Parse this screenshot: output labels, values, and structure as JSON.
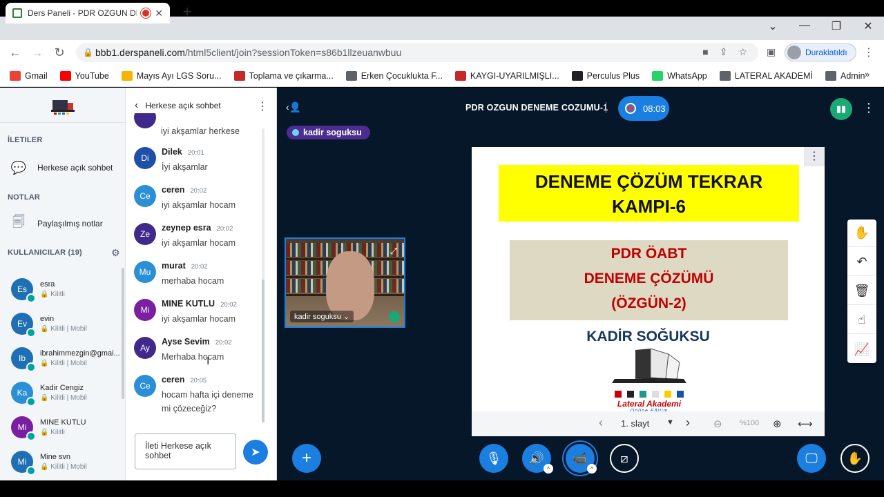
{
  "browser": {
    "tab_title": "Ders Paneli - PDR OZGUN DE",
    "url_host": "bbb1.derspaneli.com",
    "url_path": "/html5client/join?sessionToken=s86b1llzeuanwbuu",
    "profile_label": "Duraklatıldı",
    "bookmarks": [
      {
        "label": "Gmail",
        "color": "#ea4335"
      },
      {
        "label": "YouTube",
        "color": "#ff0000"
      },
      {
        "label": "Mayıs Ayı LGS Soru...",
        "color": "#f6b400"
      },
      {
        "label": "Toplama ve çıkarma...",
        "color": "#c62828"
      },
      {
        "label": "Erken Çocuklukta F...",
        "color": "#5f6368"
      },
      {
        "label": "KAYGI-UYARILMIŞLI...",
        "color": "#c62828"
      },
      {
        "label": "Perculus Plus",
        "color": "#202124"
      },
      {
        "label": "WhatsApp",
        "color": "#25d366"
      },
      {
        "label": "LATERAL AKADEMİ",
        "color": "#5f6368"
      },
      {
        "label": "Admin",
        "color": "#5f6368"
      }
    ]
  },
  "sidebar": {
    "messages_title": "İLETILER",
    "public_chat": "Herkese açık sohbet",
    "notes_title": "NOTLAR",
    "shared_notes": "Paylaşılmış notlar",
    "users_title": "KULLANICILAR (19)",
    "users": [
      {
        "initials": "Es",
        "name": "esra",
        "status": "🔒 Kilitli",
        "color": "#1f6fb5"
      },
      {
        "initials": "Ev",
        "name": "evin",
        "status": "🔒 Kilitli | Mobil",
        "color": "#1f6fb5"
      },
      {
        "initials": "Ib",
        "name": "ibrahimmezgin@gmai...",
        "status": "🔒 Kilitli | Mobil",
        "color": "#1f6fb5"
      },
      {
        "initials": "Ka",
        "name": "Kadir Cengiz",
        "status": "🔒 Kilitli | Mobil",
        "color": "#2a8fd6"
      },
      {
        "initials": "Mi",
        "name": "MINE KUTLU",
        "status": "🔒 Kilitli",
        "color": "#7b1fa2"
      },
      {
        "initials": "Mi",
        "name": "Mine svn",
        "status": "🔒 Kilitli | Mobil",
        "color": "#1f6fb5"
      }
    ]
  },
  "chat": {
    "header": "Herkese açık sohbet",
    "partial_top": "iyi akşamlar herkese",
    "messages": [
      {
        "initials": "Di",
        "name": "Dilek",
        "time": "20:01",
        "text": "İyi akşamlar",
        "color": "#1f4fa8"
      },
      {
        "initials": "Ce",
        "name": "ceren",
        "time": "20:02",
        "text": "iyi akşamlar hocam",
        "color": "#2a8fd6"
      },
      {
        "initials": "Ze",
        "name": "zeynep esra",
        "time": "20:02",
        "text": "iyi akşamlar hocam",
        "color": "#3f2a8c"
      },
      {
        "initials": "Mu",
        "name": "murat",
        "time": "20:02",
        "text": "merhaba hocam",
        "color": "#2a8fd6"
      },
      {
        "initials": "Mi",
        "name": "MINE KUTLU",
        "time": "20:02",
        "text": "iyi akşamlar hocam",
        "color": "#7b1fa2"
      },
      {
        "initials": "Ay",
        "name": "Ayse Sevim",
        "time": "20:02",
        "text": "Merhaba hocam",
        "color": "#3f2a8c"
      },
      {
        "initials": "Ce",
        "name": "ceren",
        "time": "20:05",
        "text": "hocam hafta içi deneme mi çözeceğiz?",
        "color": "#2a8fd6"
      }
    ],
    "input_placeholder": "İleti Herkese açık sohbet"
  },
  "stage": {
    "title": "PDR OZGUN DENEME COZUMU-1",
    "rec_time": "08:03",
    "talker": "kadir soguksu",
    "webcam_name": "kadir soguksu ⌄"
  },
  "slide": {
    "headline_1": "DENEME ÇÖZÜM TEKRAR",
    "headline_2": "KAMPI-6",
    "box_1": "PDR ÖABT",
    "box_2": "DENEME ÇÖZÜMÜ",
    "box_3": "(ÖZGÜN-2)",
    "author": "KADİR SOĞUKSU",
    "logo_text": "Lateral Akademi",
    "logo_sub": "Online Eğitim",
    "page_label": "1. slayt",
    "zoom": "%100"
  }
}
